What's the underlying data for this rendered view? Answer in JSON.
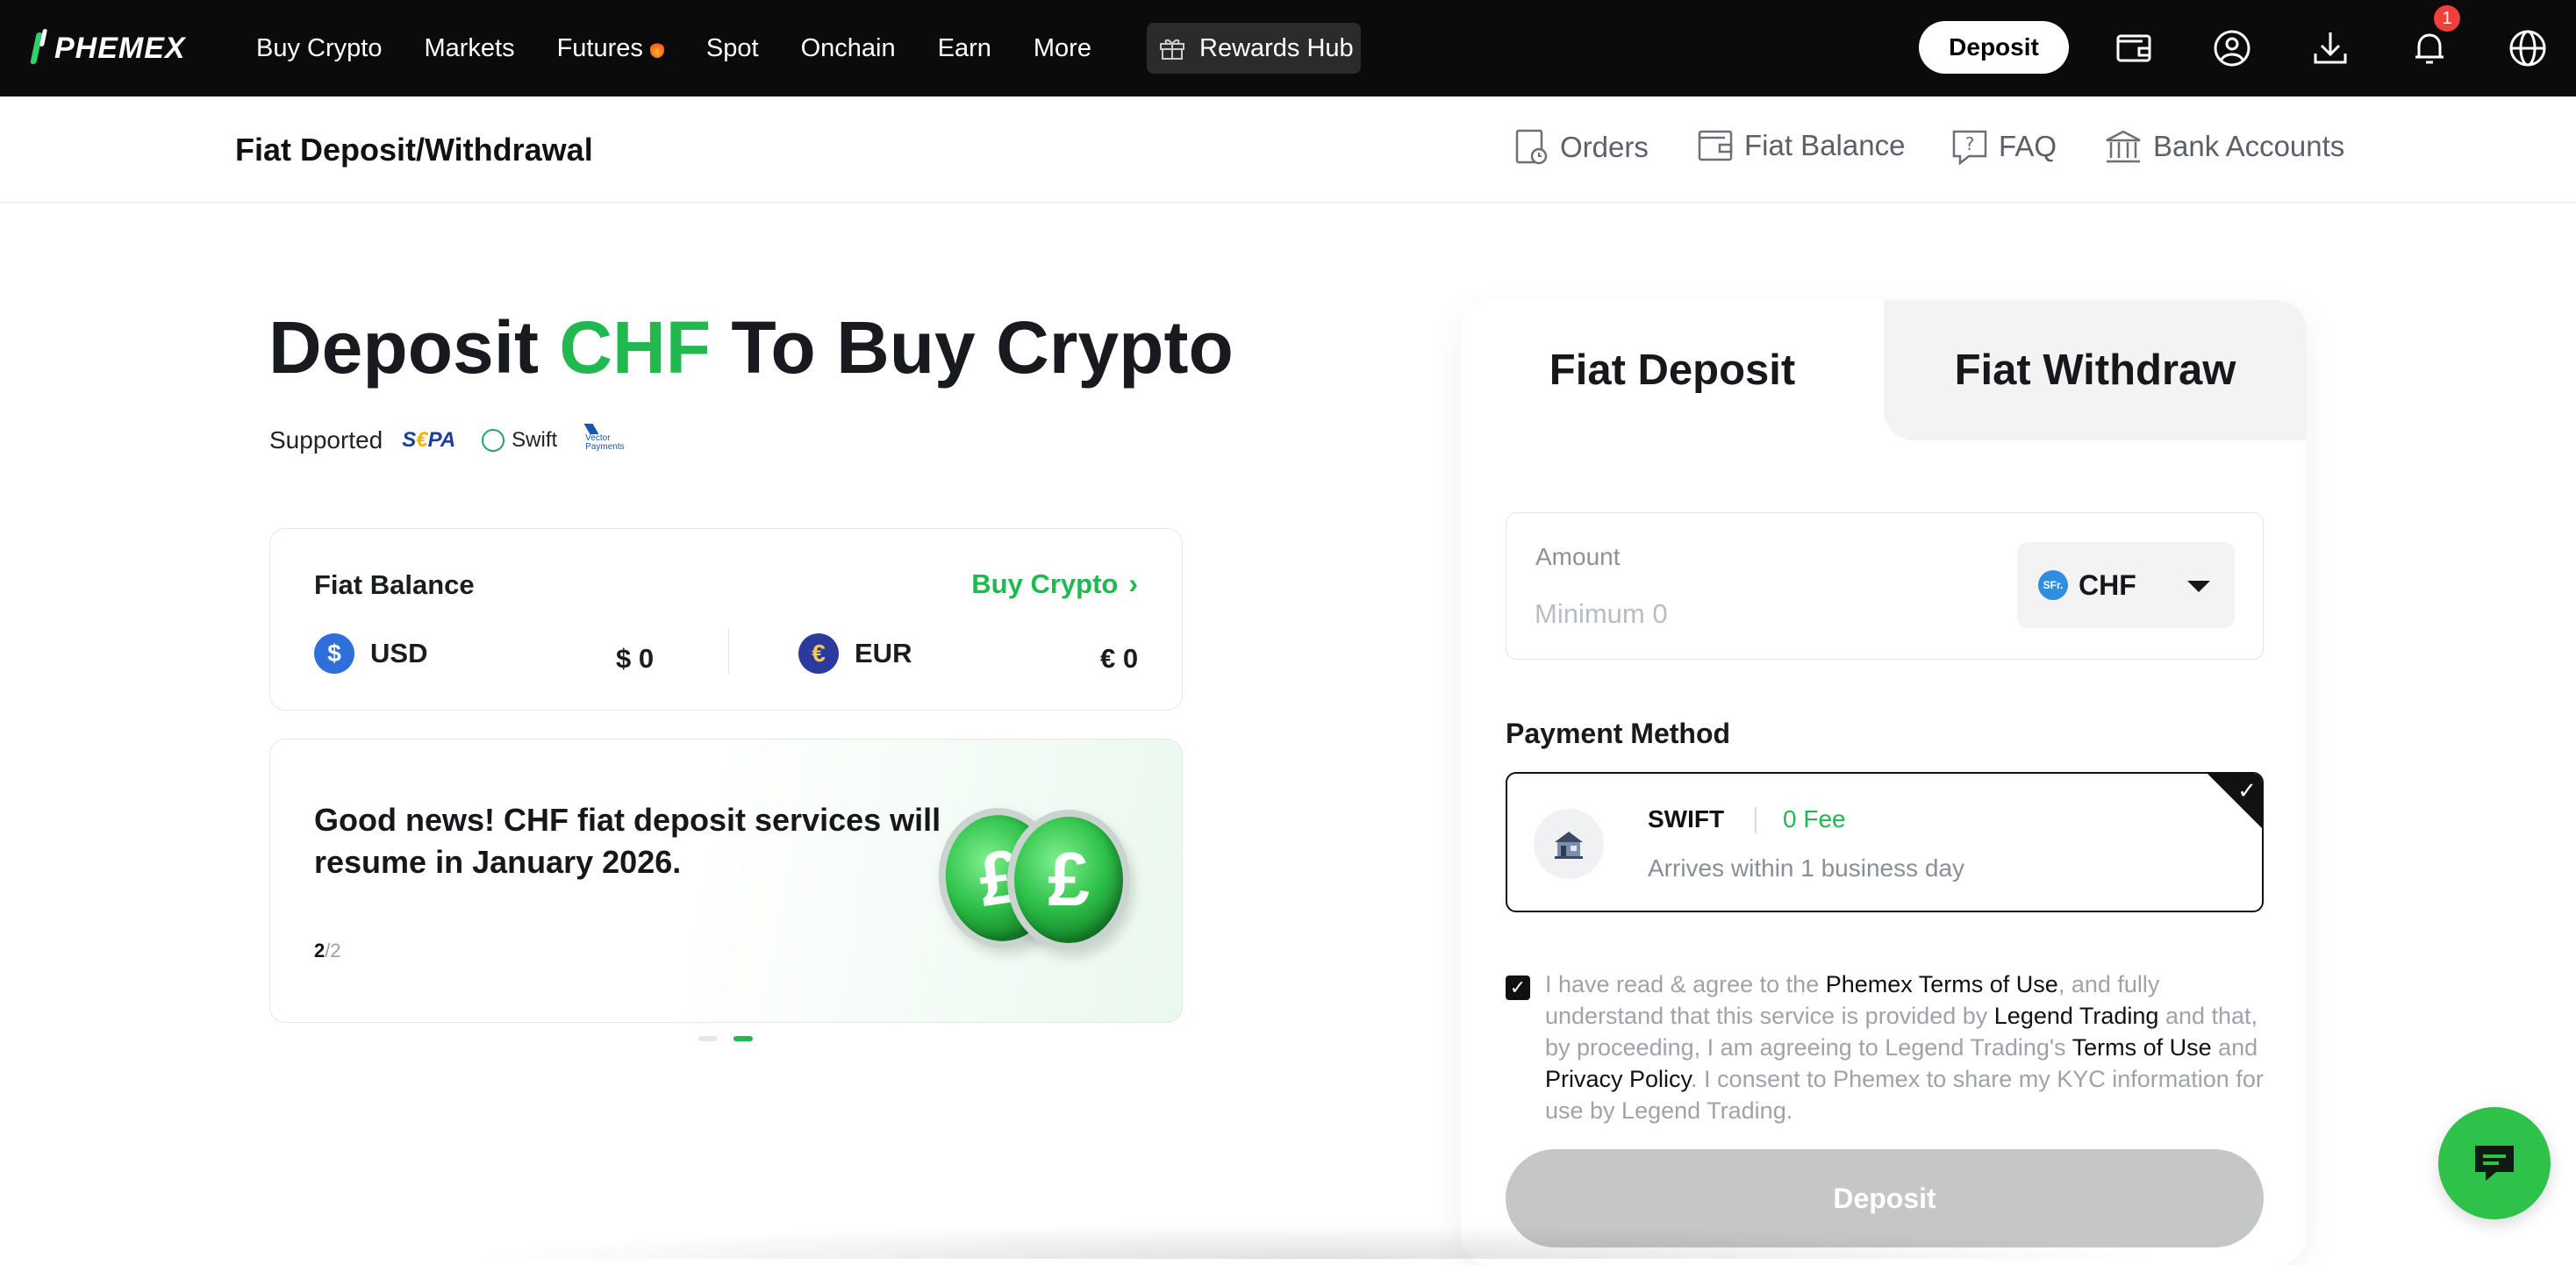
{
  "topnav": {
    "logo": "PHEMEX",
    "items": [
      "Buy Crypto",
      "Markets",
      "Futures",
      "Spot",
      "Onchain",
      "Earn",
      "More"
    ],
    "rewards": "Rewards Hub",
    "deposit": "Deposit",
    "notification_count": "1",
    "icons": [
      "wallet-icon",
      "user-icon",
      "download-icon",
      "bell-icon",
      "globe-icon"
    ]
  },
  "subnav": {
    "title": "Fiat Deposit/Withdrawal",
    "links": [
      "Orders",
      "Fiat Balance",
      "FAQ",
      "Bank Accounts"
    ]
  },
  "hero": {
    "title_prefix": "Deposit ",
    "title_accent": "CHF",
    "title_suffix": " To Buy Crypto",
    "supported_label": "Supported",
    "supported_methods": [
      "SEPA",
      "Swift",
      "Vector Payments"
    ]
  },
  "balance": {
    "title": "Fiat Balance",
    "buy_link": "Buy Crypto",
    "currencies": [
      {
        "code": "USD",
        "symbol": "$",
        "value": "$ 0",
        "color": "#2f6fd9"
      },
      {
        "code": "EUR",
        "symbol": "€",
        "value": "€ 0",
        "color": "#2b3a9c"
      }
    ]
  },
  "promo": {
    "text": "Good news! CHF fiat deposit services will resume in January 2026.",
    "page_current": "2",
    "page_total": "/2",
    "coin_symbol": "£"
  },
  "panel": {
    "tabs": [
      "Fiat Deposit",
      "Fiat Withdraw"
    ],
    "amount_label": "Amount",
    "amount_placeholder": "Minimum 0",
    "currency": "CHF",
    "currency_icon_text": "SFr.",
    "payment_method_title": "Payment Method",
    "payment": {
      "name": "SWIFT",
      "fee": "0 Fee",
      "eta": "Arrives within 1 business day"
    },
    "agreement": {
      "t1": "I have read & agree to the ",
      "l1": "Phemex Terms of Use",
      "t2": ", and fully understand that this service is provided by ",
      "l2": "Legend Trading",
      "t3": " and that, by proceeding, I am agreeing to Legend Trading's ",
      "l3": "Terms of Use",
      "t4": " and ",
      "l4": "Privacy Policy",
      "t5": ". I consent to Phemex to share my KYC information for use by Legend Trading."
    },
    "submit": "Deposit"
  },
  "colors": {
    "accent": "#20b84f",
    "nav_bg": "#0b0b0b",
    "disabled": "#c5c6c8"
  }
}
